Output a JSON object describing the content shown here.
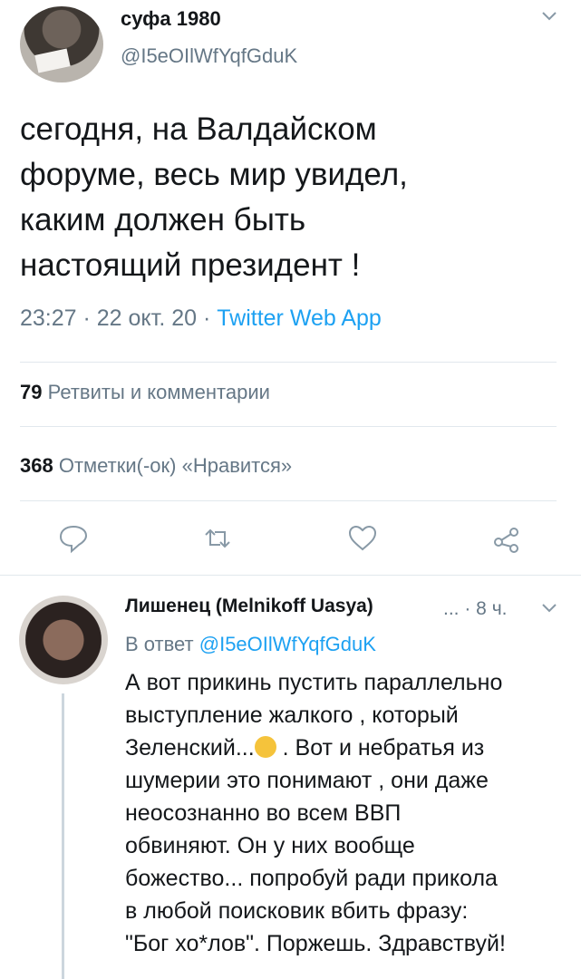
{
  "tweet": {
    "author_name": "суфа 1980",
    "handle": "@I5eOIlWfYqfGduK",
    "text": "сегодня, на Валдайском\nфоруме, весь мир увидел,\nкаким должен быть\nнастоящий президент !",
    "time": "23:27 · 22 окт. 20 · ",
    "source": "Twitter Web App",
    "retweets_count": "79",
    "retweets_label": "Ретвиты и комментарии",
    "likes_count": "368",
    "likes_label": "Отметки(-ок) «Нравится»"
  },
  "actions": [
    {
      "name": "reply-icon"
    },
    {
      "name": "retweet-icon"
    },
    {
      "name": "like-icon"
    },
    {
      "name": "share-icon"
    }
  ],
  "reply": {
    "author_name": "Лишенец (Melnikoff Uasya)",
    "ellipsis": "...",
    "time": "· 8 ч.",
    "in_reply_prefix": "В ответ ",
    "in_reply_handle": "@I5eOIlWfYqfGduK",
    "text_part1": "А вот прикинь пустить параллельно\nвыступление жалкого , который\nЗеленский...",
    "emoji": "rolling-laughing-emoji",
    "text_part2": " . Вот и небратья из\nшумерии это понимают , они даже\nнеосознанно во всем ВВП\nобвиняют. Он у них вообще\nбожество... попробуй ради прикола\nв любой поисковик вбить фразу:\n\"Бог хо*лов\". Поржешь. Здравствуй!"
  },
  "colors": {
    "accent": "#1da1f2",
    "secondary_text": "#657786",
    "divider": "#e1e8ed"
  }
}
